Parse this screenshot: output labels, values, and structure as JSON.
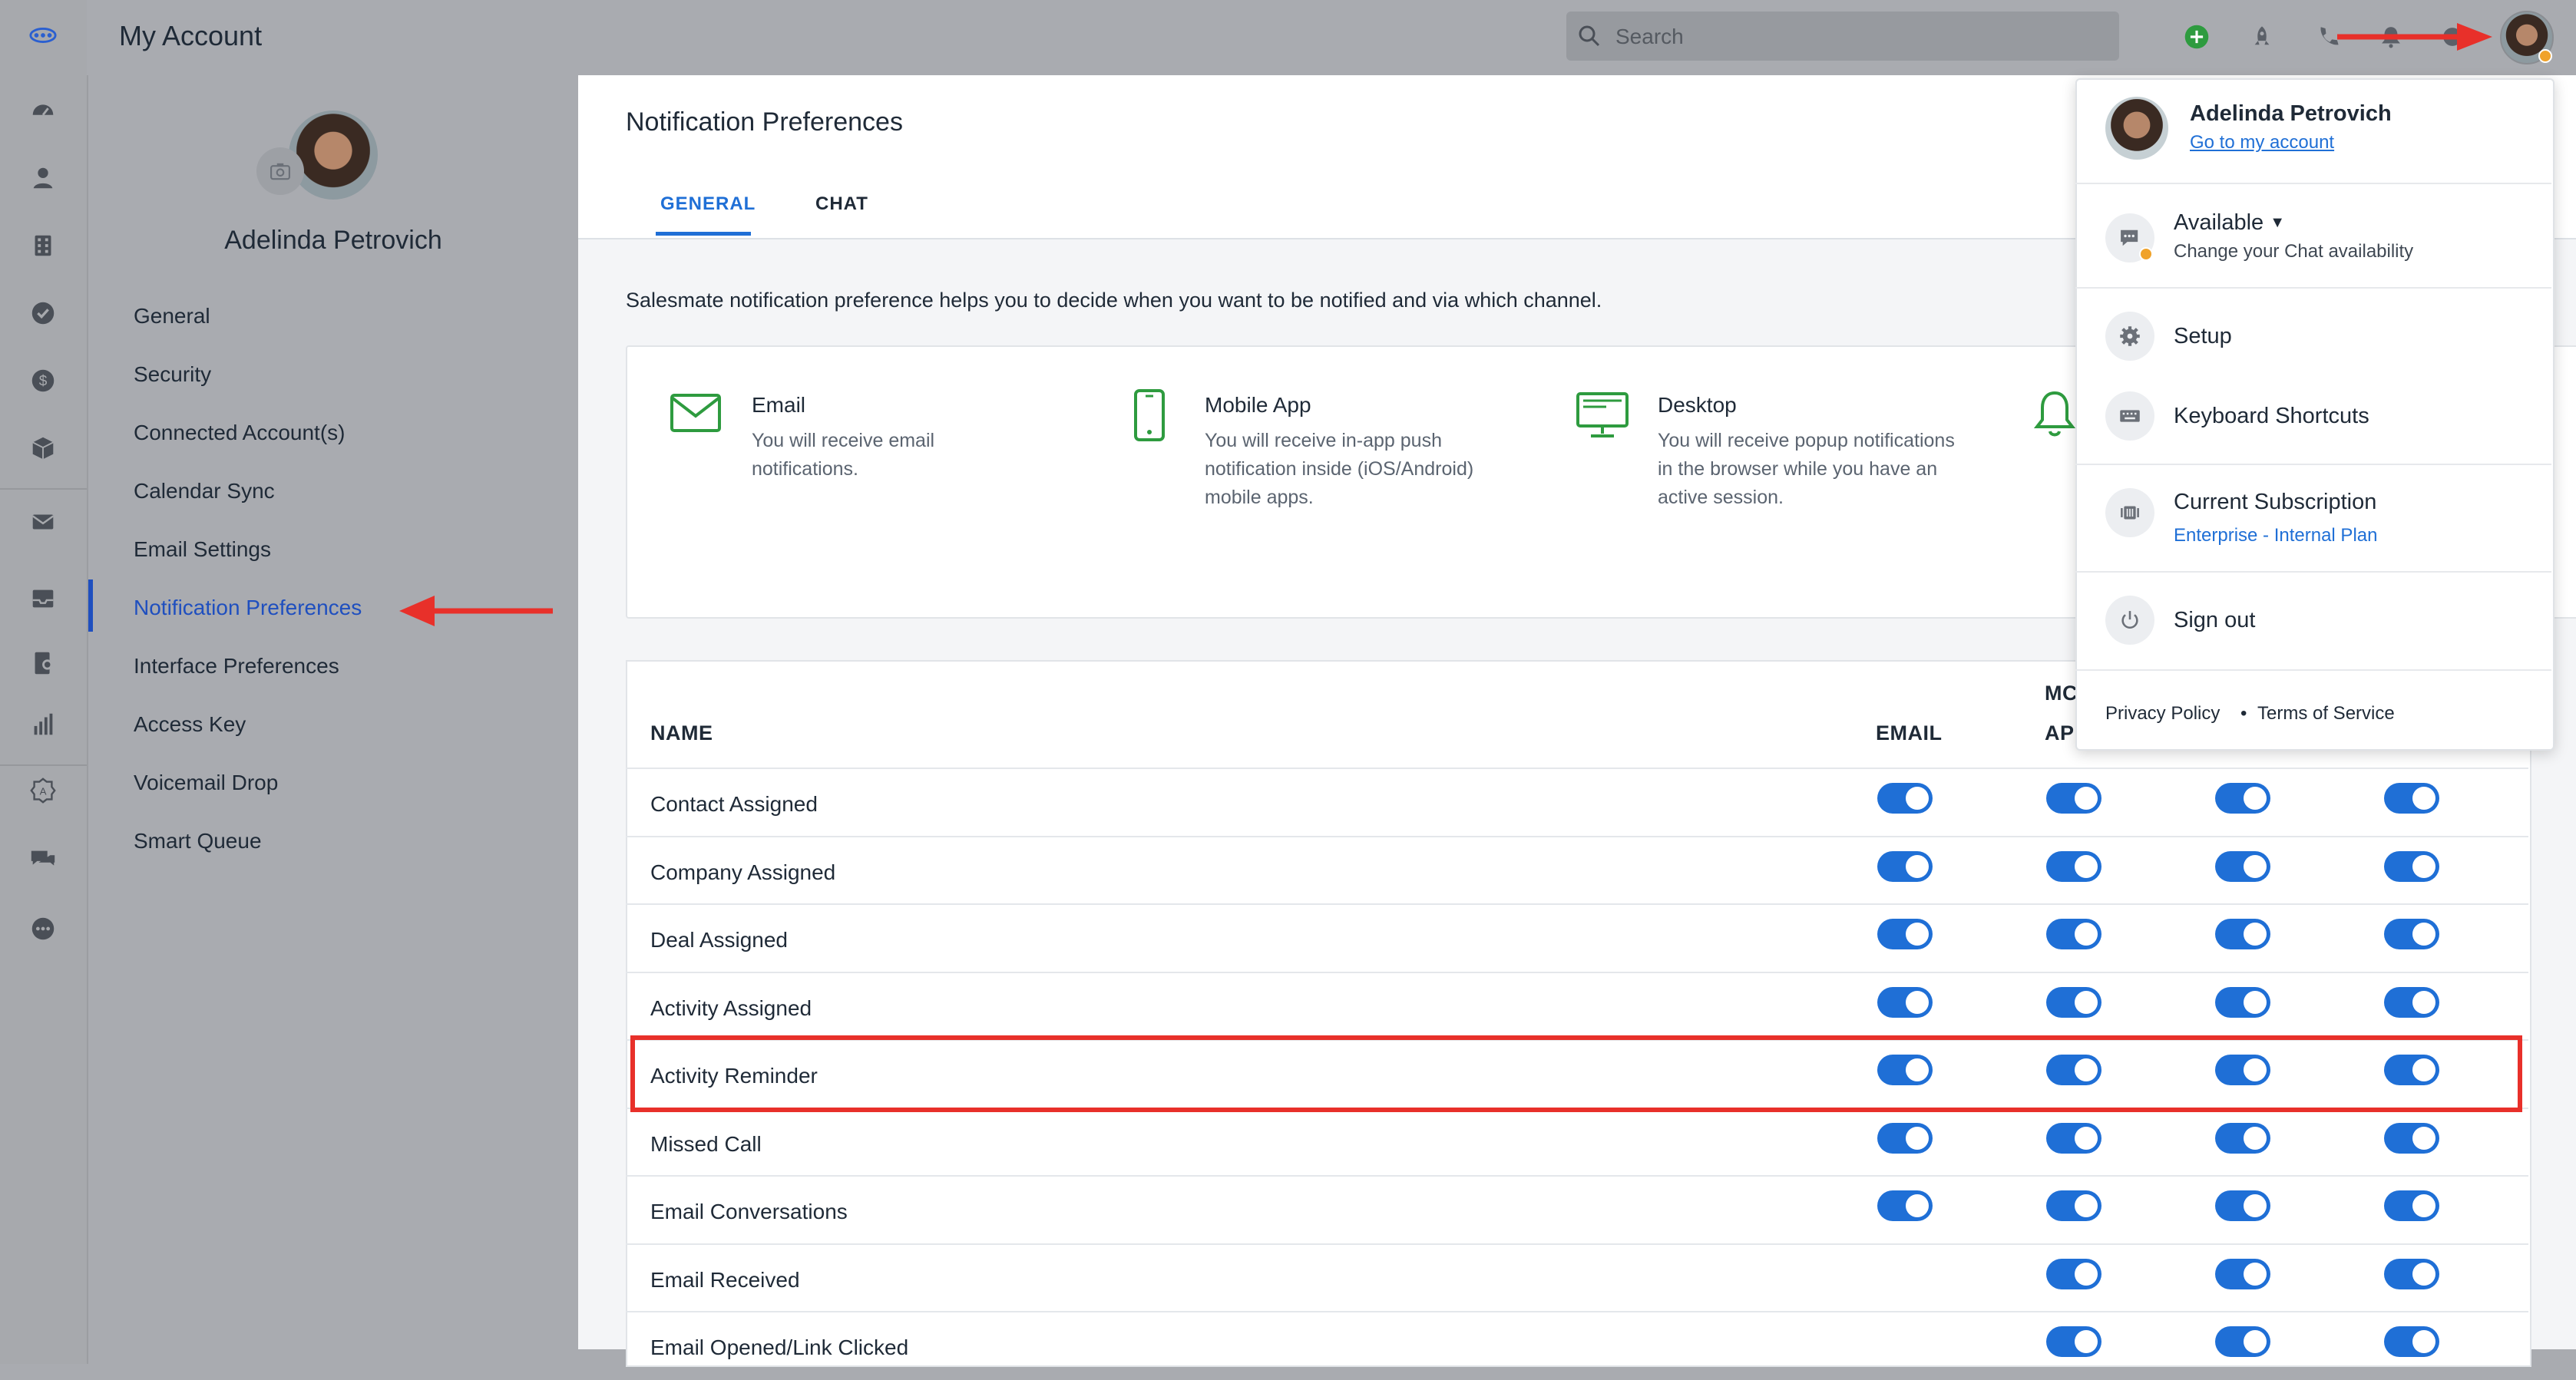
{
  "topbar": {
    "title": "My Account",
    "search_placeholder": "Search"
  },
  "rail": {
    "icons": [
      "logo-icon",
      "dashboard-icon",
      "contacts-icon",
      "companies-icon",
      "activities-icon",
      "deals-icon",
      "products-icon",
      "email-icon",
      "inbox-icon",
      "sequences-icon",
      "reports-icon",
      "app-store-icon",
      "chat-icon",
      "more-icon"
    ]
  },
  "account": {
    "user_name": "Adelinda Petrovich",
    "nav": [
      {
        "label": "General"
      },
      {
        "label": "Security"
      },
      {
        "label": "Connected Account(s)"
      },
      {
        "label": "Calendar Sync"
      },
      {
        "label": "Email Settings"
      },
      {
        "label": "Notification Preferences",
        "active": true
      },
      {
        "label": "Interface Preferences"
      },
      {
        "label": "Access Key"
      },
      {
        "label": "Voicemail Drop"
      },
      {
        "label": "Smart Queue"
      }
    ]
  },
  "main": {
    "title": "Notification Preferences",
    "tabs": [
      {
        "label": "GENERAL",
        "active": true
      },
      {
        "label": "CHAT"
      }
    ],
    "intro": "Salesmate notification preference helps you to decide when you want to be notified and via which channel.",
    "channels": [
      {
        "title": "Email",
        "desc": "You will receive email notifications.",
        "icon": "envelope-icon"
      },
      {
        "title": "Mobile App",
        "desc": "You will receive in-app push notification inside (iOS/Android) mobile apps.",
        "icon": "mobile-icon"
      },
      {
        "title": "Desktop",
        "desc": "You will receive popup notifications in the browser while you have an active session.",
        "icon": "desktop-icon"
      }
    ],
    "table": {
      "headers": {
        "name": "NAME",
        "email": "EMAIL",
        "mobile_line1": "MC",
        "mobile_line2": "AP"
      },
      "rows": [
        {
          "name": "Contact Assigned",
          "toggles": [
            true,
            true,
            true,
            true
          ]
        },
        {
          "name": "Company Assigned",
          "toggles": [
            true,
            true,
            true,
            true
          ]
        },
        {
          "name": "Deal Assigned",
          "toggles": [
            true,
            true,
            true,
            true
          ]
        },
        {
          "name": "Activity Assigned",
          "toggles": [
            true,
            true,
            true,
            true
          ]
        },
        {
          "name": "Activity Reminder",
          "toggles": [
            true,
            true,
            true,
            true
          ]
        },
        {
          "name": "Missed Call",
          "toggles": [
            true,
            true,
            true,
            true
          ]
        },
        {
          "name": "Email Conversations",
          "toggles": [
            true,
            true,
            true,
            true
          ]
        },
        {
          "name": "Email Received",
          "toggles": [
            null,
            true,
            true,
            true
          ]
        },
        {
          "name": "Email Opened/Link Clicked",
          "toggles": [
            null,
            true,
            true,
            true
          ]
        }
      ]
    }
  },
  "dropdown": {
    "user_name": "Adelinda Petrovich",
    "account_link": "Go to my account",
    "status": "Available",
    "status_sub": "Change your Chat availability",
    "setup": "Setup",
    "shortcuts": "Keyboard Shortcuts",
    "subscription": "Current Subscription",
    "plan": "Enterprise - Internal Plan",
    "sign_out": "Sign out",
    "privacy": "Privacy Policy",
    "bullet": "•",
    "terms": "Terms of Service"
  },
  "colors": {
    "accent": "#1f6fd6",
    "active_nav": "#1f4fbf",
    "annotation_red": "#e8302a",
    "add_green": "#2e9b3f",
    "status_orange": "#f0a22a"
  }
}
